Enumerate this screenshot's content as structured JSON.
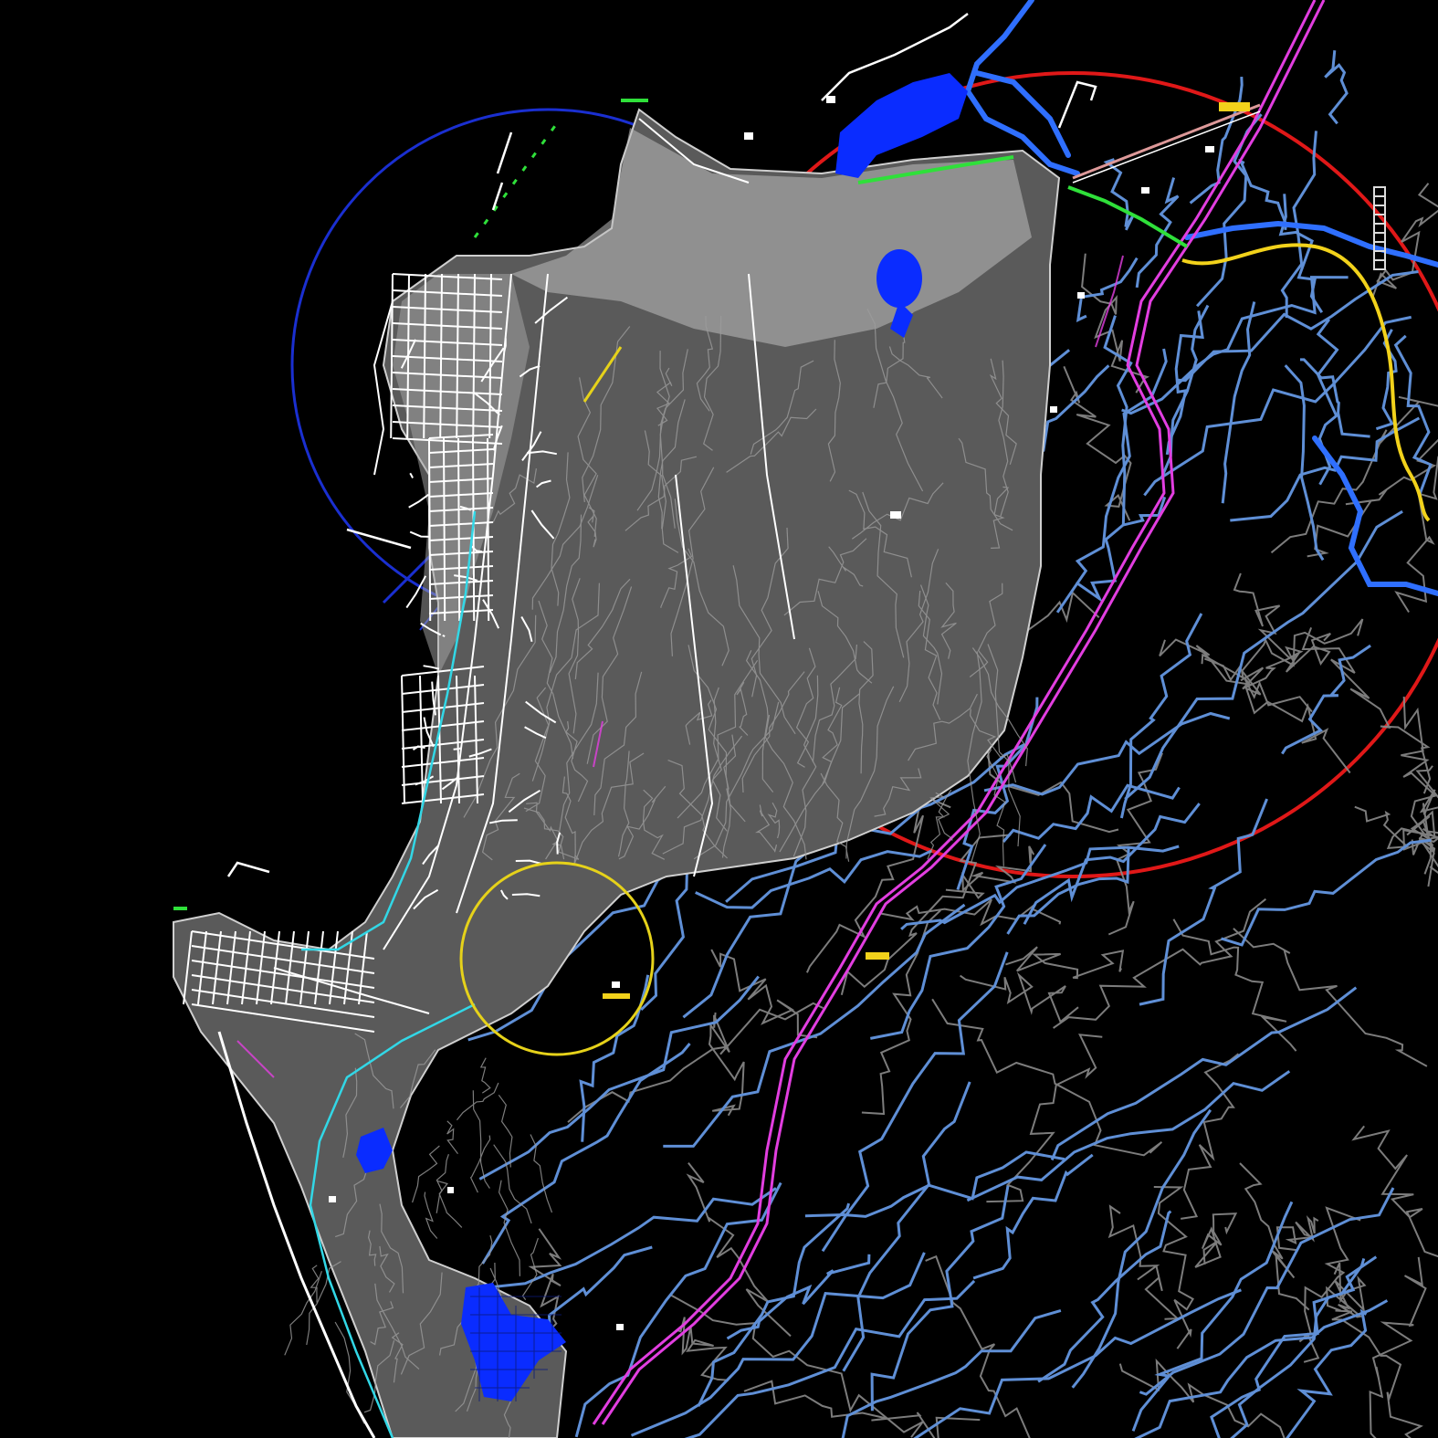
{
  "canvas": {
    "background": "#000000"
  },
  "colors": {
    "terrain_fill": "#5a5a5a",
    "terrain_light": "#d8d8d8",
    "street": "#ffffff",
    "contour": "#8a8a8a",
    "stream": "#5f8fd6",
    "stream_bright": "#2f6fff",
    "road_magenta": "#e23ee0",
    "red_ring": "#e01818",
    "blue_ring": "#1a2fd0",
    "yellow_ring": "#e6d21a",
    "route_yellow": "#f2d21b",
    "water": "#0a2cff",
    "coast_cyan": "#32d7e6",
    "highlight_green": "#2fe03a"
  },
  "layers": [
    {
      "name": "urban-street-grid",
      "color_key": "street"
    },
    {
      "name": "topographic-contours",
      "color_key": "contour"
    },
    {
      "name": "drainage-network",
      "color_key": "stream"
    },
    {
      "name": "highway",
      "color_key": "road_magenta"
    },
    {
      "name": "buffer-rings",
      "color_key": "red_ring"
    },
    {
      "name": "water-bodies",
      "color_key": "water"
    }
  ]
}
